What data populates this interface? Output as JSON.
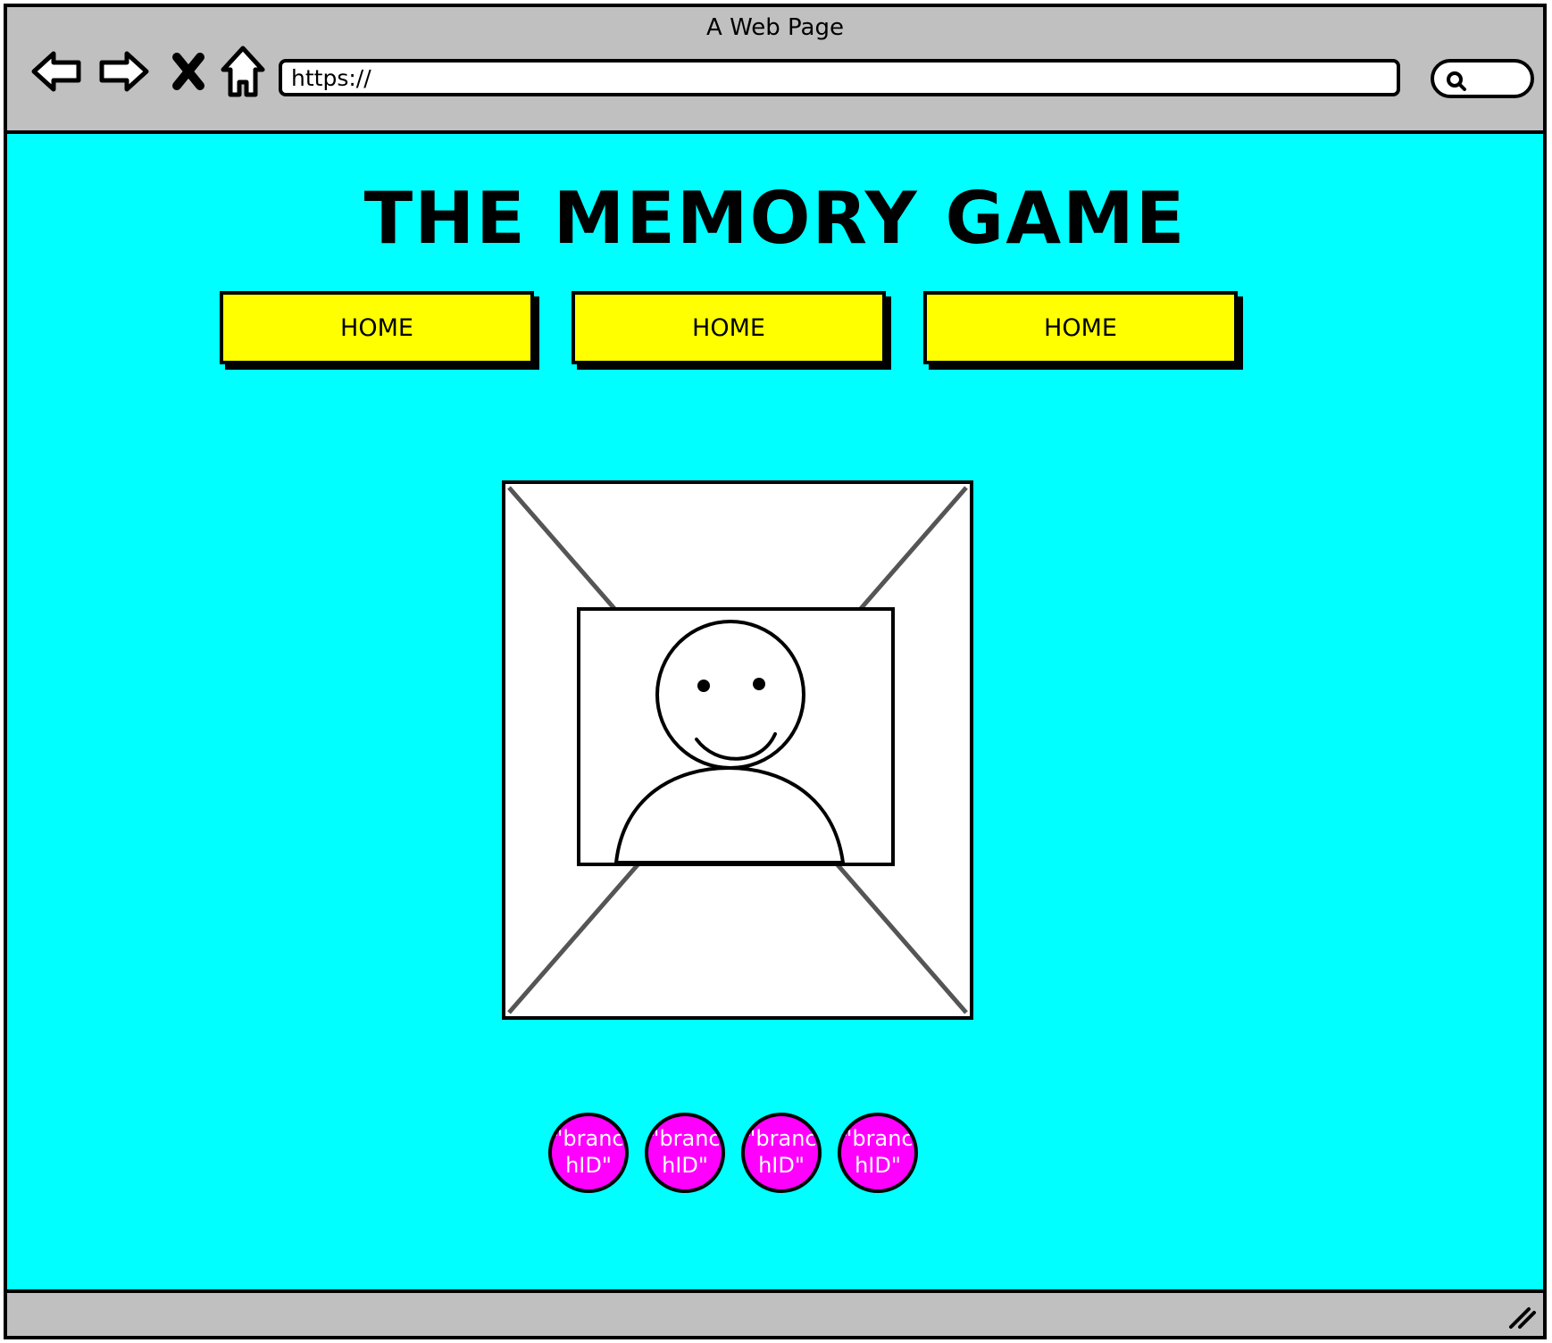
{
  "window": {
    "title": "A Web Page",
    "url": "https://"
  },
  "page": {
    "title": "THE MEMORY GAME",
    "nav_buttons": [
      "HOME",
      "HOME",
      "HOME"
    ],
    "image_placeholder": "person-placeholder",
    "circles": [
      "\"branchID\"",
      "\"branchID\"",
      "\"branchID\"",
      "\"branchID\""
    ]
  },
  "colors": {
    "background": "#00ffff",
    "button": "#ffff00",
    "circle": "#ff00ff",
    "chrome": "#c0c0c0"
  }
}
